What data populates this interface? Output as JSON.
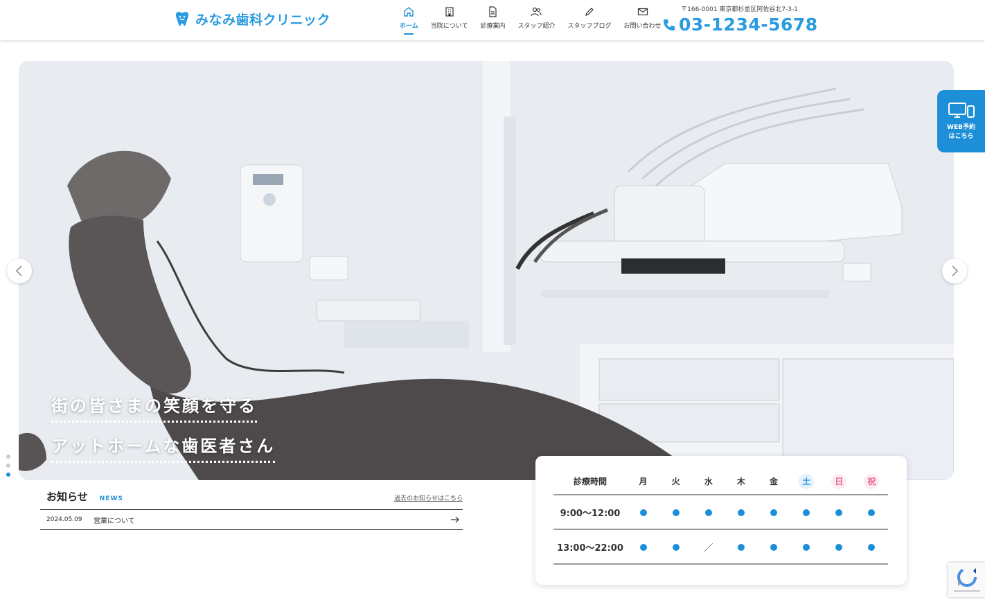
{
  "header": {
    "logo_text": "みなみ歯科クリニック",
    "address": "〒166-0001 東京都杉並区阿佐谷北7-3-1",
    "phone": "03-1234-5678"
  },
  "nav": {
    "home": "ホーム",
    "about": "当院について",
    "treatment": "診療案内",
    "staff": "スタッフ紹介",
    "blog": "スタッフブログ",
    "contact": "お問い合わせ"
  },
  "hero": {
    "catch_line1": "街の皆さまの笑顔を守る",
    "catch_line2": "アットホームな歯医者さん"
  },
  "web_reserve": {
    "line1": "WEB予約",
    "line2": "はこちら"
  },
  "news": {
    "title": "お知らせ",
    "subtitle": "NEWS",
    "more_link": "過去のお知らせはこちら",
    "items": [
      {
        "date": "2024.05.09",
        "text": "営業について"
      }
    ]
  },
  "hours": {
    "header_label": "診療時間",
    "days": [
      "月",
      "火",
      "水",
      "木",
      "金",
      "土",
      "日",
      "祝"
    ],
    "rows": [
      {
        "time": "9:00〜12:00",
        "marks": [
          "●",
          "●",
          "●",
          "●",
          "●",
          "●",
          "●",
          "●"
        ]
      },
      {
        "time": "13:00〜22:00",
        "marks": [
          "●",
          "●",
          "／",
          "●",
          "●",
          "●",
          "●",
          "●"
        ]
      }
    ]
  },
  "colors": {
    "accent": "#1c8fd8",
    "saturday": "#2a9be0",
    "sunday_holiday": "#e8658a"
  }
}
